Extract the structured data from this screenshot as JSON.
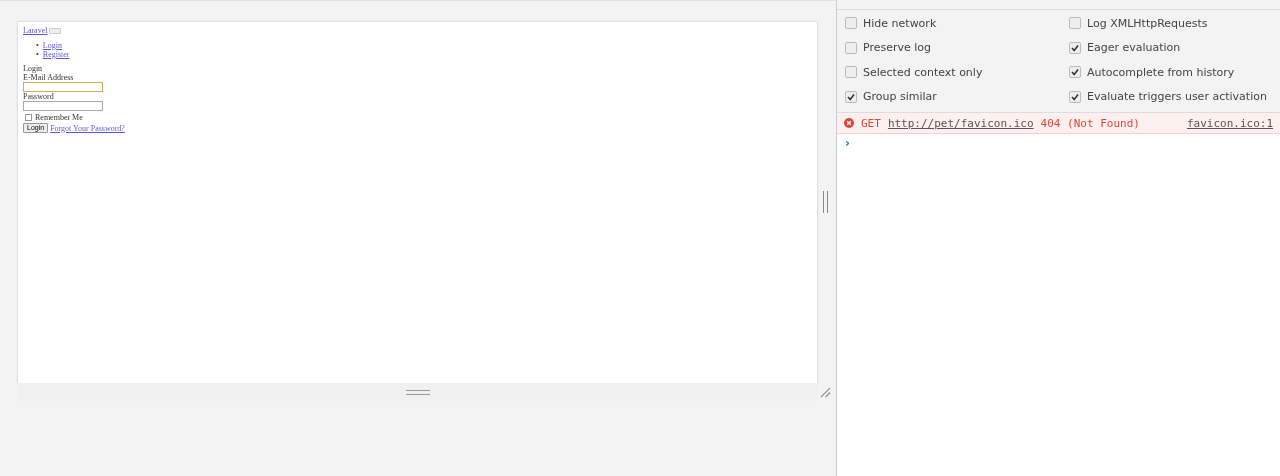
{
  "page": {
    "brand": "Laravel",
    "nav": [
      {
        "marker": "•",
        "label": "Login"
      },
      {
        "marker": "•",
        "label": "Register"
      }
    ],
    "heading": "Login",
    "email_label": "E-Mail Address",
    "password_label": "Password",
    "remember": {
      "label": "Remember Me",
      "checked": false
    },
    "submit": "Login",
    "forgot_link": "Forgot Your Password?"
  },
  "console": {
    "settings": [
      {
        "label": "Hide network",
        "checked": false
      },
      {
        "label": "Log XMLHttpRequests",
        "checked": false
      },
      {
        "label": "Preserve log",
        "checked": false
      },
      {
        "label": "Eager evaluation",
        "checked": true
      },
      {
        "label": "Selected context only",
        "checked": false
      },
      {
        "label": "Autocomplete from history",
        "checked": true
      },
      {
        "label": "Group similar",
        "checked": true
      },
      {
        "label": "Evaluate triggers user activation",
        "checked": true
      }
    ],
    "messages": [
      {
        "method": "GET",
        "url": "http://pet/favicon.ico",
        "status": "404 (Not Found)",
        "source": "favicon.ico:1"
      }
    ],
    "prompt": "›"
  }
}
